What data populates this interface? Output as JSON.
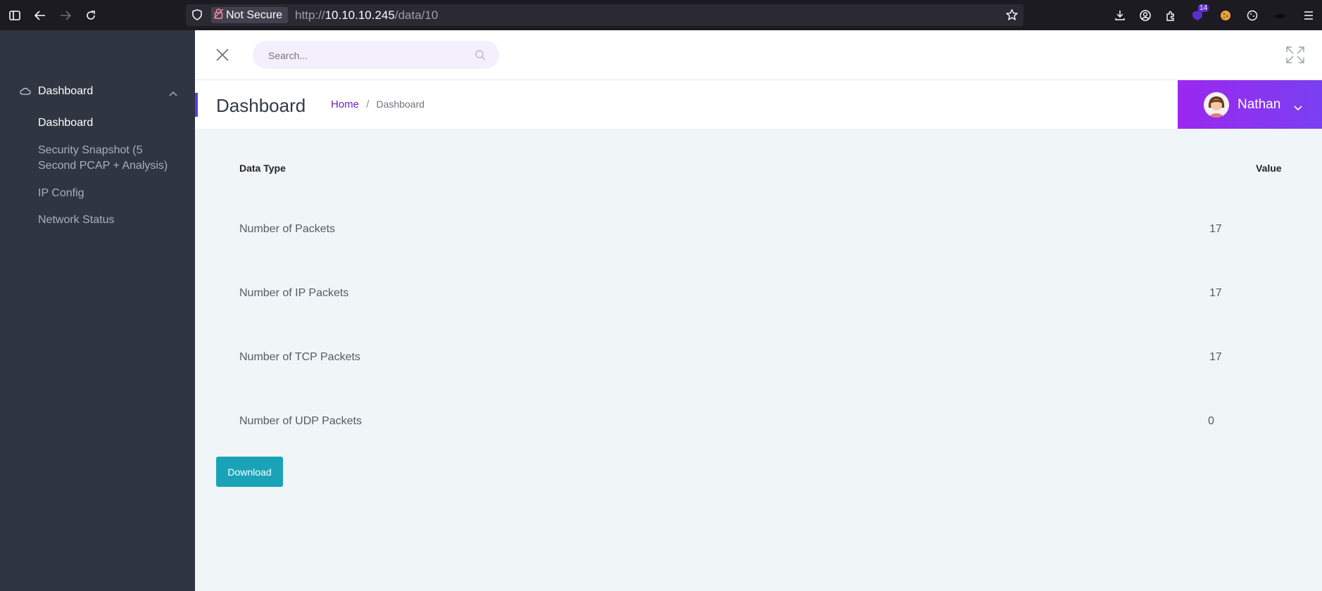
{
  "browser": {
    "security_label": "Not Secure",
    "url_prefix": "http://",
    "url_host": "10.10.10.245",
    "url_path": "/data/10",
    "extension_badge": "14"
  },
  "sidebar": {
    "section_label": "Dashboard",
    "items": [
      {
        "label": "Dashboard"
      },
      {
        "label": "Security Snapshot (5 Second PCAP + Analysis)"
      },
      {
        "label": "IP Config"
      },
      {
        "label": "Network Status"
      }
    ]
  },
  "topbar": {
    "search_placeholder": "Search..."
  },
  "page": {
    "title": "Dashboard",
    "breadcrumb_home": "Home",
    "breadcrumb_sep": "/",
    "breadcrumb_current": "Dashboard"
  },
  "user": {
    "name": "Nathan"
  },
  "table": {
    "headers": [
      "Data Type",
      "Value"
    ],
    "rows": [
      {
        "label": "Number of Packets",
        "value": "17"
      },
      {
        "label": "Number of IP Packets",
        "value": "17"
      },
      {
        "label": "Number of TCP Packets",
        "value": "17"
      },
      {
        "label": "Number of UDP Packets",
        "value": "0"
      }
    ]
  },
  "actions": {
    "download_label": "Download"
  },
  "colors": {
    "sidebar_bg": "#2f3541",
    "accent": "#5b3cd8",
    "user_gradient_start": "#9c27f0",
    "download_bg": "#1aa3b8",
    "link": "#6a1fc9"
  }
}
